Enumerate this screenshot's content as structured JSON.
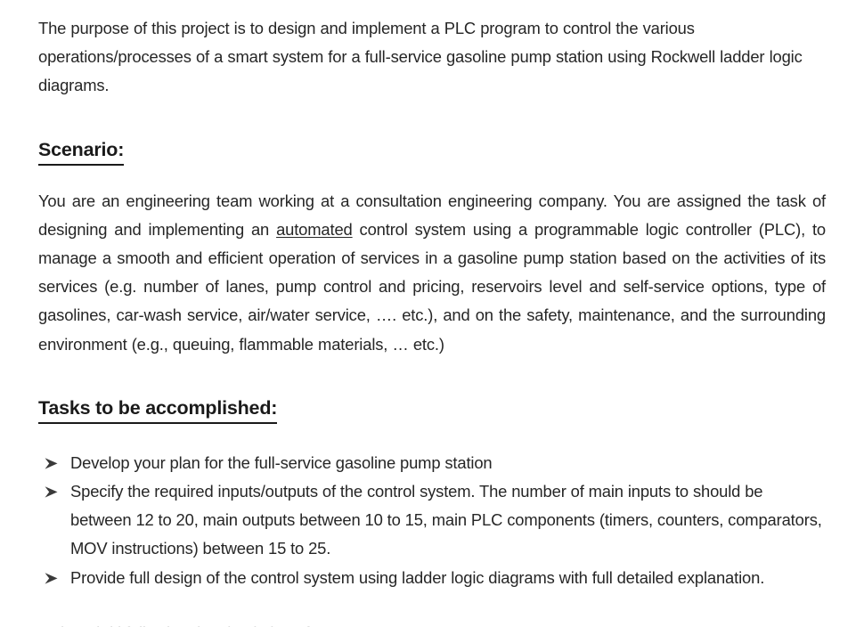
{
  "document": {
    "background_color": "#ffffff",
    "text_color": "#262626",
    "heading_color": "#1a1a1a",
    "intro_paragraph": "The purpose of this project is to design and implement a PLC program to control the various operations/processes of a smart system for a full-service gasoline pump station using Rockwell ladder logic diagrams.",
    "sections": {
      "scenario": {
        "heading": "Scenario:",
        "body_part_1": "You are an engineering team working at a consultation engineering company. You are assigned the task of designing and implementing an ",
        "body_emphasis": "automated",
        "body_part_2": " control system using a programmable logic controller (PLC), to manage a smooth and efficient operation of services in a gasoline pump station based on the activities of its services (e.g. number of lanes, pump control and pricing, reservoirs level and self-service options, type of gasolines, car-wash service, air/water service, …. etc.), and on the safety, maintenance, and the surrounding environment (e.g., queuing, flammable materials, … etc.)"
      },
      "tasks": {
        "heading": "Tasks to be accomplished:",
        "bullet_glyph": "arrowhead-bullet-icon",
        "items": [
          "Develop your plan for the full-service gasoline pump station",
          "Specify the required inputs/outputs of the control system. The number of main inputs to should be between 12 to 20, main outputs between 10 to 15, main PLC components (timers, counters, comparators, MOV instructions) between 15 to 25.",
          "Provide full design of the control system using ladder logic diagrams with full detailed explanation."
        ],
        "clipped_next_line": "In the  a         l d l                      following the simulation of"
      }
    }
  }
}
